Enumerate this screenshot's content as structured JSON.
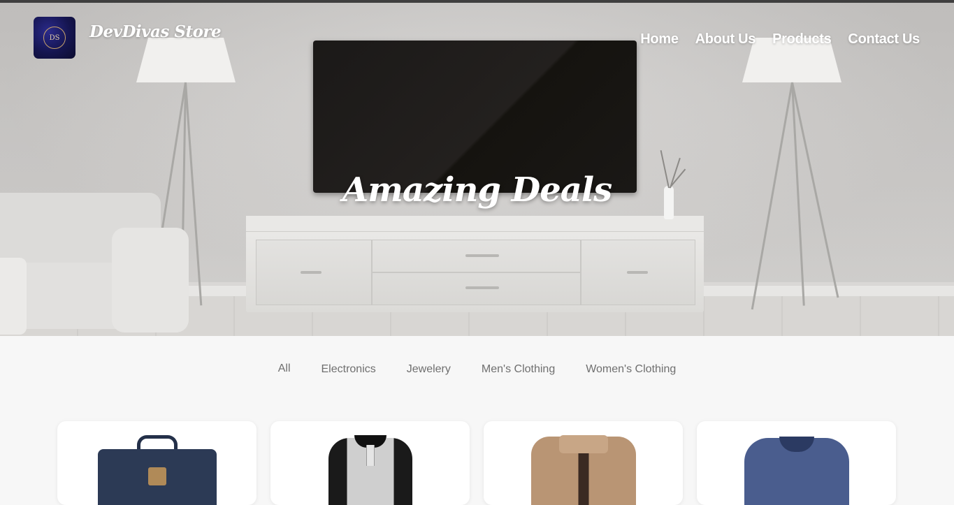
{
  "brand": {
    "name": "DevDivas Store",
    "logo_text": "DS",
    "logo_icon": "store-logo-icon"
  },
  "nav": {
    "items": [
      {
        "label": "Home"
      },
      {
        "label": "About Us"
      },
      {
        "label": "Products"
      },
      {
        "label": "Contact Us"
      }
    ]
  },
  "hero": {
    "title": "Amazing Deals",
    "image": "living-room-tv-hero-image"
  },
  "filters": {
    "items": [
      {
        "label": "All",
        "active": true
      },
      {
        "label": "Electronics"
      },
      {
        "label": "Jewelery"
      },
      {
        "label": "Men's Clothing"
      },
      {
        "label": "Women's Clothing"
      }
    ]
  },
  "products": {
    "items": [
      {
        "image": "backpack-image"
      },
      {
        "image": "raglan-henley-shirt-image"
      },
      {
        "image": "cotton-jacket-image"
      },
      {
        "image": "slim-fit-tshirt-image"
      }
    ]
  },
  "colors": {
    "nav_text": "#ffffff",
    "filter_text": "#6f6f6f",
    "page_bg": "#f7f7f7",
    "card_bg": "#ffffff"
  }
}
